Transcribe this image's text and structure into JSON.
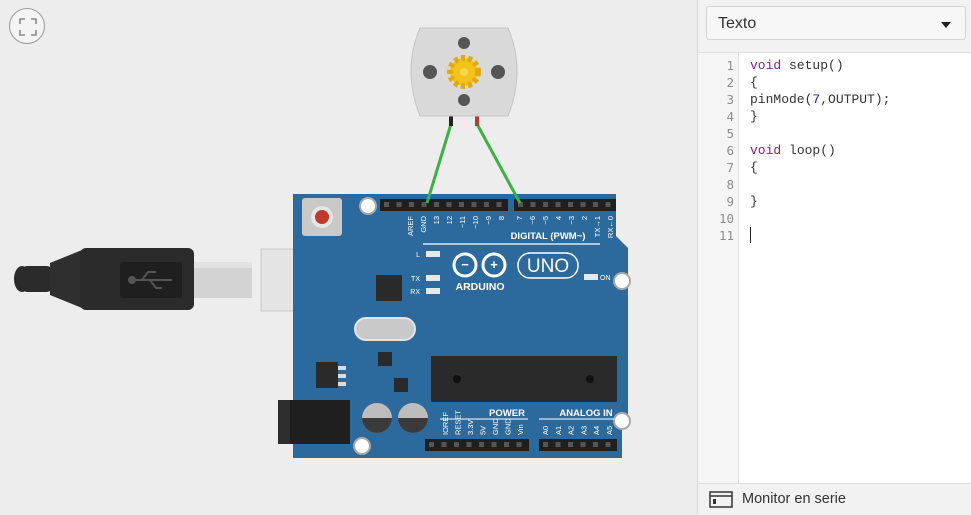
{
  "editor_mode": {
    "selected": "Texto"
  },
  "code": {
    "line_numbers": [
      "1",
      "2",
      "3",
      "4",
      "5",
      "6",
      "7",
      "8",
      "9",
      "10",
      "11"
    ],
    "lines": [
      [
        {
          "t": "void",
          "k": "kw"
        },
        {
          "t": " setup()",
          "k": ""
        }
      ],
      [
        {
          "t": "{",
          "k": ""
        }
      ],
      [
        {
          "t": "pinMode(",
          "k": ""
        },
        {
          "t": "7",
          "k": "num"
        },
        {
          "t": ",OUTPUT);",
          "k": ""
        }
      ],
      [
        {
          "t": "}",
          "k": ""
        }
      ],
      [],
      [
        {
          "t": "void",
          "k": "kw"
        },
        {
          "t": " loop()",
          "k": ""
        }
      ],
      [
        {
          "t": "{",
          "k": ""
        }
      ],
      [],
      [
        {
          "t": "}",
          "k": ""
        }
      ],
      [],
      []
    ]
  },
  "serial_monitor": {
    "label": "Monitor en serie"
  },
  "board": {
    "brand": "ARDUINO",
    "model": "UNO",
    "digital_label": "DIGITAL (PWM~)",
    "power_label": "POWER",
    "analog_label": "ANALOG IN",
    "led_labels": [
      "L",
      "TX",
      "RX"
    ],
    "on_label": "ON",
    "digital_pins": [
      "AREF",
      "GND",
      "13",
      "12",
      "~11",
      "~10",
      "~9",
      "8",
      "7",
      "~6",
      "~5",
      "4",
      "~3",
      "2",
      "TX→1",
      "RX←0"
    ],
    "power_pins": [
      "IOREF",
      "RESET",
      "3.3V",
      "5V",
      "GND",
      "GND",
      "Vin"
    ],
    "analog_pins": [
      "A0",
      "A1",
      "A2",
      "A3",
      "A4",
      "A5"
    ]
  },
  "colors": {
    "board": "#2c6a9e",
    "wire": "#3cb043",
    "motor_body": "#d9d9d9",
    "gear": "#f2c318"
  }
}
